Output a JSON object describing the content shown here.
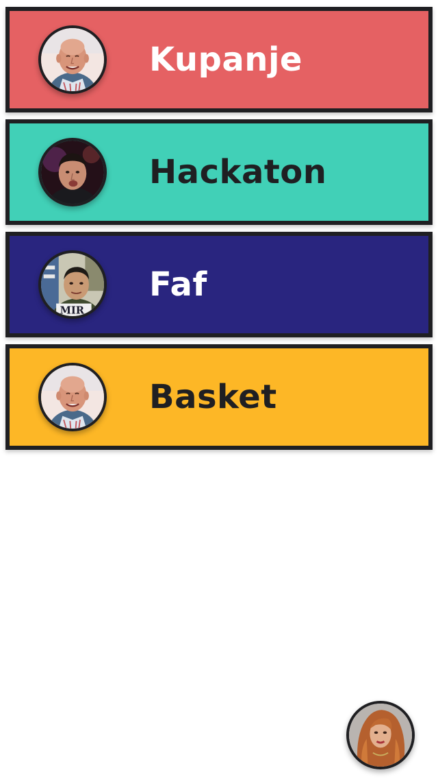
{
  "cards": [
    {
      "title": "Kupanje",
      "color": "#e56163",
      "text_color": "#ffffff",
      "avatar": "bald-man-avatar"
    },
    {
      "title": "Hackaton",
      "color": "#41d0b7",
      "text_color": "#1f1f22",
      "avatar": "man-avatar-dark"
    },
    {
      "title": "Faf",
      "color": "#29257f",
      "text_color": "#ffffff",
      "avatar": "man-avatar-poster"
    },
    {
      "title": "Basket",
      "color": "#fdb726",
      "text_color": "#1f1f22",
      "avatar": "bald-man-avatar"
    }
  ],
  "fab": {
    "avatar": "woman-avatar"
  }
}
